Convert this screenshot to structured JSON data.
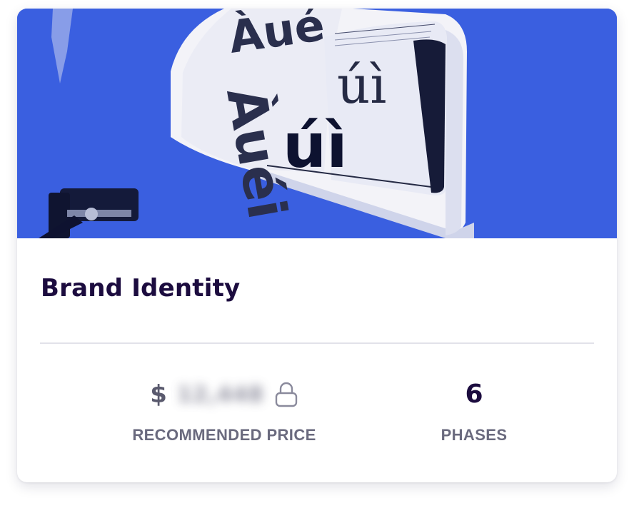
{
  "card": {
    "title": "Brand Identity",
    "hero": {
      "icon": "typography-book-image",
      "glyphs_large": "úì",
      "glyphs_bold": "úì",
      "glyphs_left": "Àué"
    },
    "stats": {
      "price": {
        "currency": "$",
        "amount_hidden": "12,448",
        "label": "RECOMMENDED PRICE",
        "icon": "lock-icon"
      },
      "phases": {
        "value": "6",
        "label": "PHASES"
      }
    }
  },
  "colors": {
    "hero_background": "#3a5fe0",
    "title": "#1c0c3f",
    "label": "#6a6a7e"
  }
}
